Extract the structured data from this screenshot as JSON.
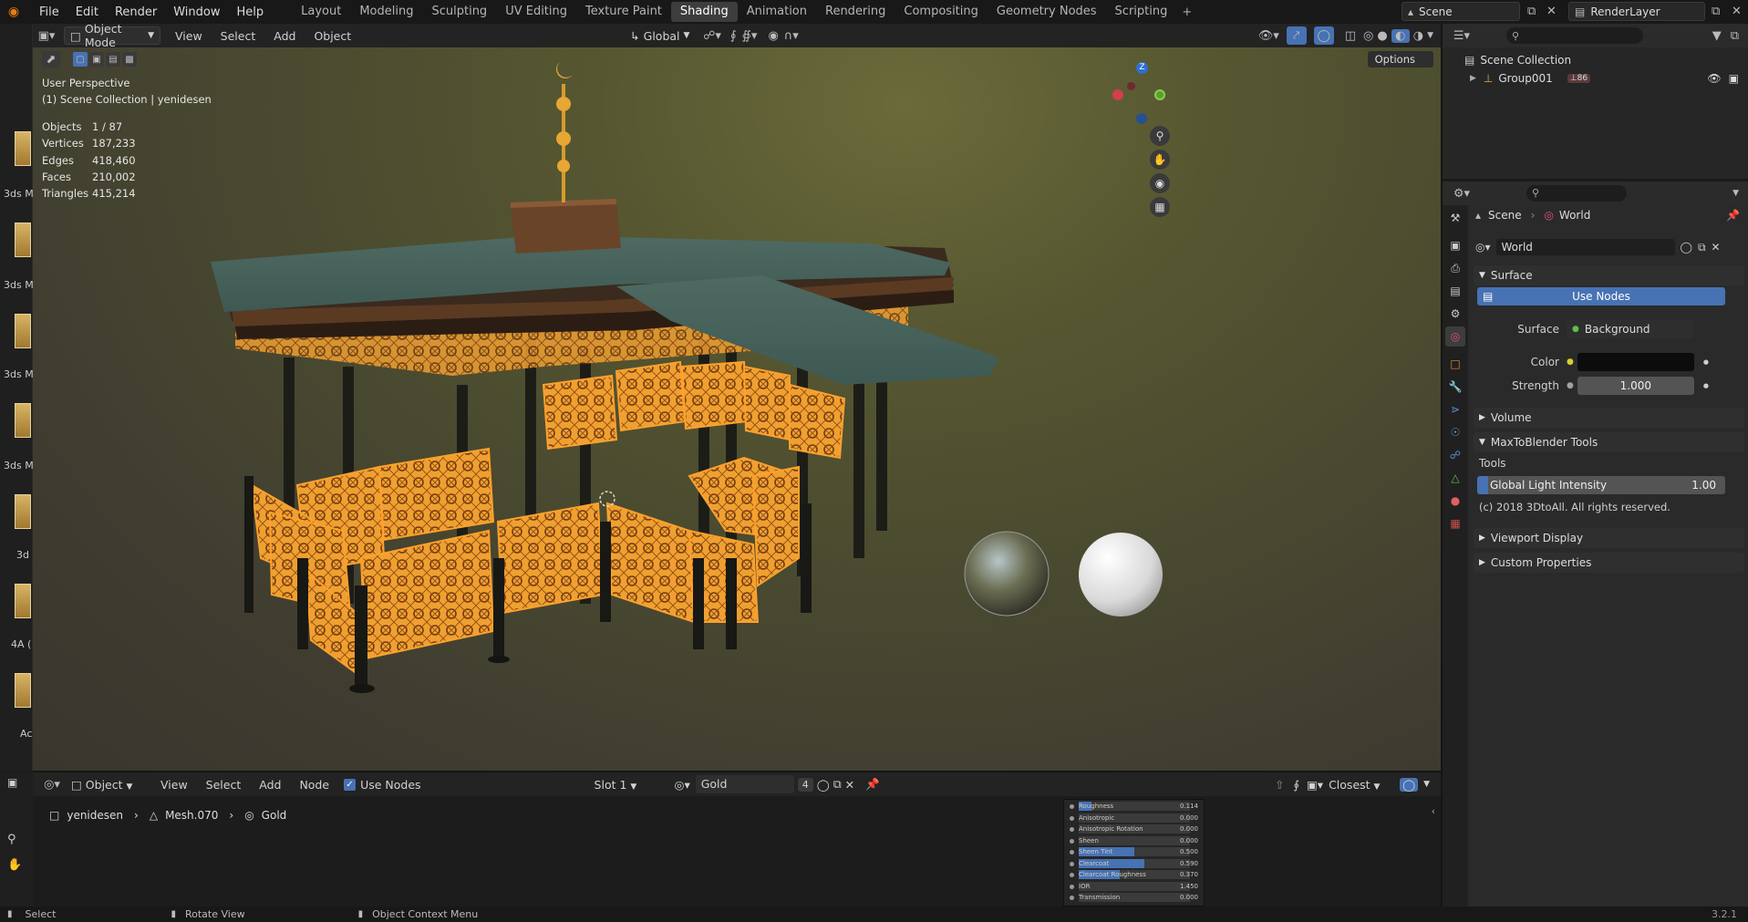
{
  "topbar": {
    "menus": [
      "File",
      "Edit",
      "Render",
      "Window",
      "Help"
    ],
    "workspaces": [
      "Layout",
      "Modeling",
      "Sculpting",
      "UV Editing",
      "Texture Paint",
      "Shading",
      "Animation",
      "Rendering",
      "Compositing",
      "Geometry Nodes",
      "Scripting"
    ],
    "active_workspace": "Shading",
    "scene": "Scene",
    "view_layer": "RenderLayer"
  },
  "viewport": {
    "mode": "Object Mode",
    "menus": [
      "View",
      "Select",
      "Add",
      "Object"
    ],
    "orientation": "Global",
    "options_label": "Options",
    "perspective": "User Perspective",
    "collection": "(1) Scene Collection | yenidesen",
    "stats": [
      {
        "k": "Objects",
        "v": "1 / 87"
      },
      {
        "k": "Vertices",
        "v": "187,233"
      },
      {
        "k": "Edges",
        "v": "418,460"
      },
      {
        "k": "Faces",
        "v": "210,002"
      },
      {
        "k": "Triangles",
        "v": "415,214"
      }
    ],
    "gizmo_z": "Z"
  },
  "asset_strip": [
    "3ds M",
    "3ds M",
    "3ds M",
    "3ds M",
    "3d",
    "4A (",
    "Ac"
  ],
  "outliner": {
    "root": "Scene Collection",
    "items": [
      {
        "label": "Group001",
        "count": "86"
      }
    ]
  },
  "properties": {
    "breadcrumb": [
      "Scene",
      "World"
    ],
    "world_name": "World",
    "surface_panel": "Surface",
    "use_nodes": "Use Nodes",
    "surface_label": "Surface",
    "surface_value": "Background",
    "color_label": "Color",
    "strength_label": "Strength",
    "strength_value": "1.000",
    "volume_panel": "Volume",
    "maxto_panel": "MaxToBlender Tools",
    "tools_label": "Tools",
    "global_light_label": "Global Light Intensity",
    "global_light_value": "1.00",
    "copyright": "(c) 2018 3DtoAll. All rights reserved.",
    "viewport_display": "Viewport Display",
    "custom_props": "Custom Properties"
  },
  "shader_editor": {
    "type": "Object",
    "menus": [
      "View",
      "Select",
      "Add",
      "Node"
    ],
    "use_nodes": "Use Nodes",
    "slot": "Slot 1",
    "material": "Gold",
    "users": "4",
    "interp": "Closest",
    "breadcrumb": [
      "yenidesen",
      "Mesh.070",
      "Gold"
    ],
    "node_rows": [
      {
        "k": "Roughness",
        "v": "0.114",
        "fill": 0.114
      },
      {
        "k": "Anisotropic",
        "v": "0.000",
        "fill": 0
      },
      {
        "k": "Anisotropic Rotation",
        "v": "0.000",
        "fill": 0
      },
      {
        "k": "Sheen",
        "v": "0.000",
        "fill": 0
      },
      {
        "k": "Sheen Tint",
        "v": "0.500",
        "fill": 0.5
      },
      {
        "k": "Clearcoat",
        "v": "0.590",
        "fill": 0.59
      },
      {
        "k": "Clearcoat Roughness",
        "v": "0.370",
        "fill": 0.37
      },
      {
        "k": "IOR",
        "v": "1.450",
        "fill": 0
      },
      {
        "k": "Transmission",
        "v": "0.000",
        "fill": 0
      }
    ]
  },
  "statusbar": {
    "select": "Select",
    "rotate": "Rotate View",
    "context": "Object Context Menu",
    "version": "3.2.1"
  },
  "colors": {
    "accent": "#4772b3",
    "gold": "#f0a030",
    "selected_outline": "#ffa12c"
  }
}
